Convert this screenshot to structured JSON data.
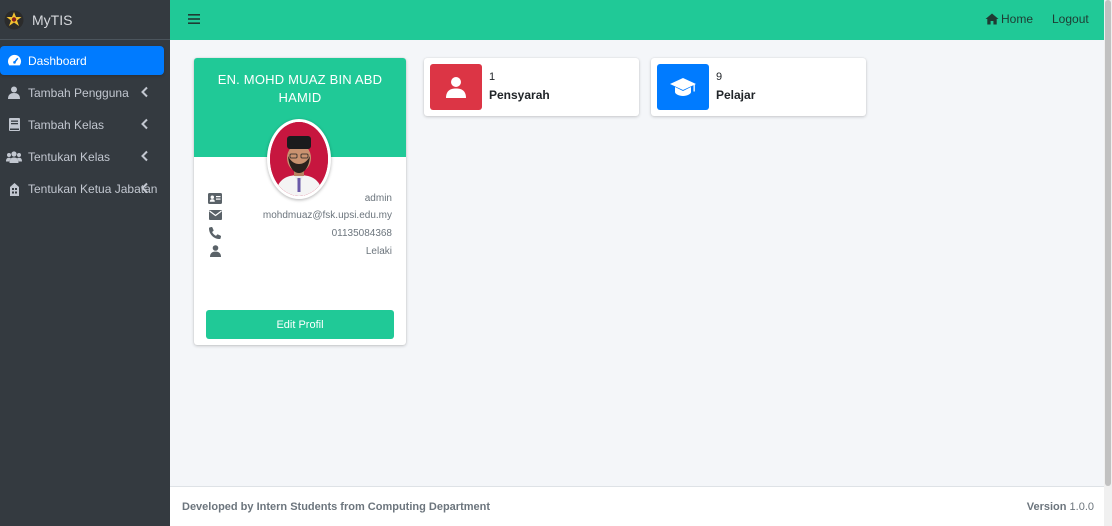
{
  "brand": {
    "title": "MyTIS"
  },
  "sidebar": {
    "items": [
      {
        "label": "Dashboard",
        "icon": "tachometer-icon",
        "active": true
      },
      {
        "label": "Tambah Pengguna",
        "icon": "user-icon",
        "expandable": true
      },
      {
        "label": "Tambah Kelas",
        "icon": "book-icon",
        "expandable": true
      },
      {
        "label": "Tentukan Kelas",
        "icon": "users-icon",
        "expandable": true
      },
      {
        "label": "Tentukan Ketua Jabatan",
        "icon": "building-icon",
        "expandable": true
      }
    ]
  },
  "topbar": {
    "home_label": "Home",
    "logout_label": "Logout"
  },
  "profile": {
    "name": "EN. MOHD MUAZ BIN ABD HAMID",
    "role": "admin",
    "email": "mohdmuaz@fsk.upsi.edu.my",
    "phone": "01135084368",
    "gender": "Lelaki",
    "edit_label": "Edit Profil"
  },
  "stats": [
    {
      "value": "1",
      "label": "Pensyarah",
      "color": "#dc3545",
      "icon": "user-icon"
    },
    {
      "value": "9",
      "label": "Pelajar",
      "color": "#007bff",
      "icon": "graduation-cap-icon"
    }
  ],
  "footer": {
    "credit": "Developed by Intern Students from Computing Department",
    "version_label": "Version",
    "version_value": "1.0.0"
  },
  "colors": {
    "accent": "#20c997",
    "sidebar": "#343a40",
    "active": "#007bff"
  }
}
